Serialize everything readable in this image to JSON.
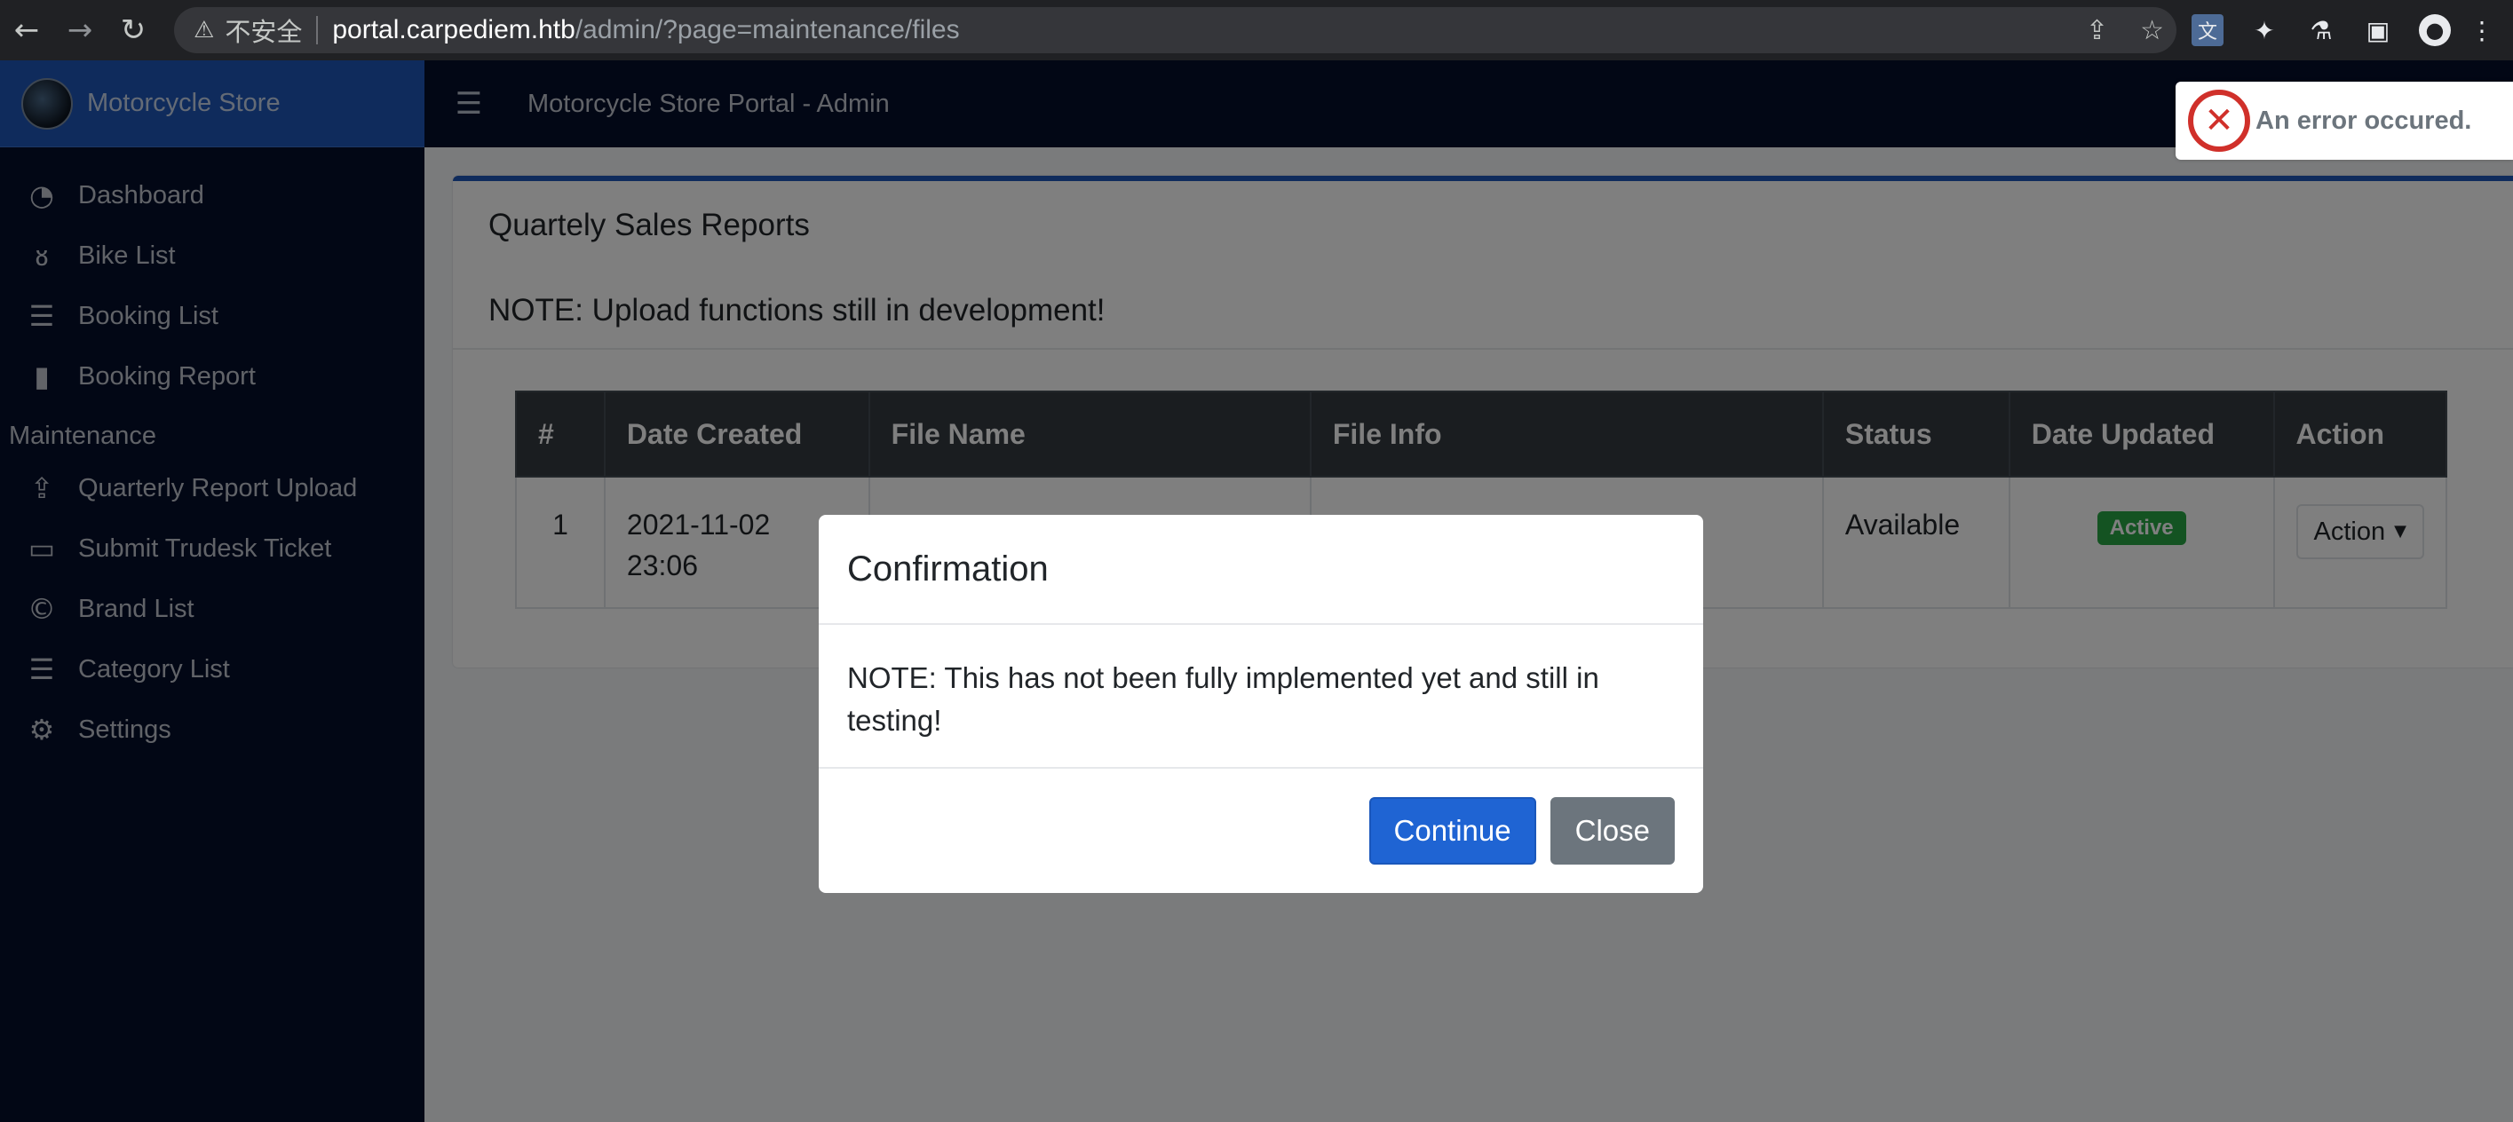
{
  "browser": {
    "warning_icon": "warning-triangle-icon",
    "insecure_label": "不安全",
    "url_host": "portal.carpediem.htb",
    "url_path": "/admin/?page=maintenance/files"
  },
  "sidebar": {
    "brand": "Motorcycle Store",
    "items": [
      {
        "label": "Dashboard",
        "icon": "dashboard-icon"
      },
      {
        "label": "Bike List",
        "icon": "motorcycle-icon"
      },
      {
        "label": "Booking List",
        "icon": "list-icon"
      },
      {
        "label": "Booking Report",
        "icon": "file-icon"
      }
    ],
    "section_header": "Maintenance",
    "maintenance_items": [
      {
        "label": "Quarterly Report Upload",
        "icon": "upload-icon"
      },
      {
        "label": "Submit Trudesk Ticket",
        "icon": "ticket-icon"
      },
      {
        "label": "Brand List",
        "icon": "copyright-icon"
      },
      {
        "label": "Category List",
        "icon": "list-icon"
      },
      {
        "label": "Settings",
        "icon": "gears-icon"
      }
    ]
  },
  "topbar": {
    "title": "Motorcycle Store Portal - Admin"
  },
  "card": {
    "title": "Quartely Sales Reports",
    "note": "NOTE: Upload functions still in development!"
  },
  "table": {
    "headers": [
      "#",
      "Date Created",
      "File Name",
      "File Info",
      "Status",
      "Date Updated",
      "Action"
    ],
    "rows": [
      {
        "num": "1",
        "date_created_date": "2021-11-02",
        "date_created_time": "23:06",
        "status": "Available",
        "badge": "Active",
        "action": "Action"
      }
    ]
  },
  "modal": {
    "title": "Confirmation",
    "body": "NOTE: This has not been fully implemented yet and still in testing!",
    "continue_label": "Continue",
    "close_label": "Close"
  },
  "toast": {
    "message": "An error occured."
  },
  "colors": {
    "sidebar_bg": "#050f2a",
    "brand_bg": "#1f57b8",
    "primary": "#1f64d3",
    "secondary": "#6c757d",
    "success": "#28a745",
    "danger": "#d0302a"
  }
}
